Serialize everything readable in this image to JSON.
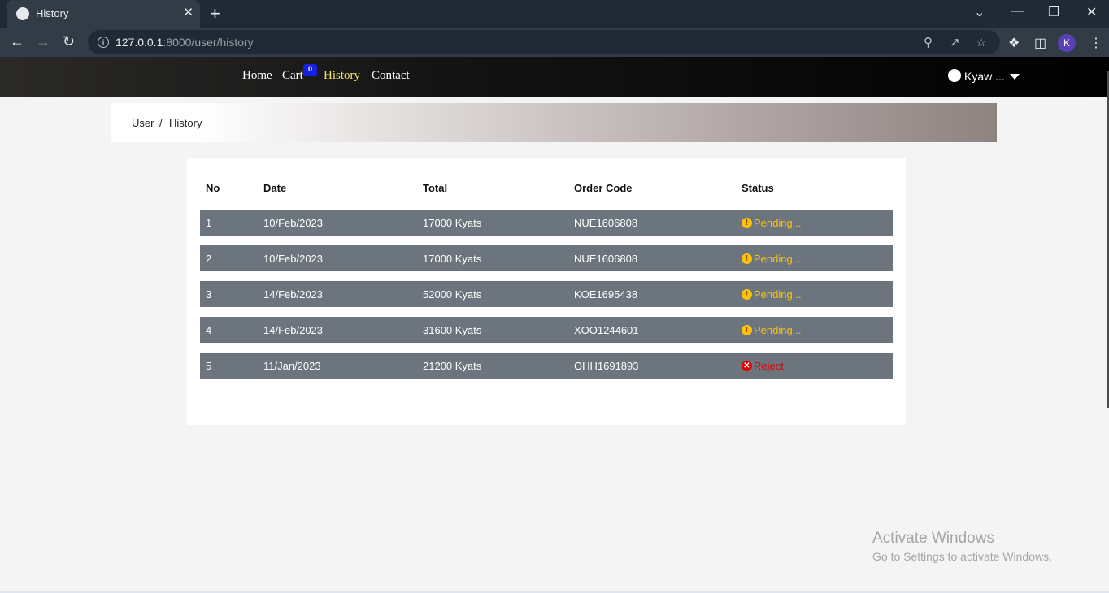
{
  "browser": {
    "tab_title": "History",
    "tab_close": "✕",
    "new_tab": "+",
    "url_host": "127.0.0.1",
    "url_path": ":8000/user/history",
    "profile_initial": "K",
    "window_controls": [
      "⌄",
      "—",
      "❐",
      "✕"
    ]
  },
  "site": {
    "nav": [
      "Home",
      "Cart",
      "History",
      "Contact"
    ],
    "active_nav": "History",
    "cart_count": "0",
    "user_name": "Kyaw ..."
  },
  "breadcrumb": {
    "items": [
      "User",
      "History"
    ],
    "separator": "/"
  },
  "table": {
    "headers": [
      "No",
      "Date",
      "Total",
      "Order Code",
      "Status"
    ],
    "rows": [
      {
        "no": "1",
        "date": "10/Feb/2023",
        "total": "17000 Kyats",
        "code": "NUE1606808",
        "status": "Pending...",
        "status_type": "pending"
      },
      {
        "no": "2",
        "date": "10/Feb/2023",
        "total": "17000 Kyats",
        "code": "NUE1606808",
        "status": "Pending...",
        "status_type": "pending"
      },
      {
        "no": "3",
        "date": "14/Feb/2023",
        "total": "52000 Kyats",
        "code": "KOE1695438",
        "status": "Pending...",
        "status_type": "pending"
      },
      {
        "no": "4",
        "date": "14/Feb/2023",
        "total": "31600 Kyats",
        "code": "XOO1244601",
        "status": "Pending...",
        "status_type": "pending"
      },
      {
        "no": "5",
        "date": "11/Jan/2023",
        "total": "21200 Kyats",
        "code": "OHH1691893",
        "status": "Reject",
        "status_type": "reject"
      }
    ]
  },
  "watermark": {
    "line1": "Activate Windows",
    "line2": "Go to Settings to activate Windows."
  },
  "colors": {
    "row_bg": "#6c757d",
    "pending": "#ffc107",
    "reject": "#e00000",
    "active_nav": "#f4e35a",
    "cart_badge": "#1520e0"
  }
}
